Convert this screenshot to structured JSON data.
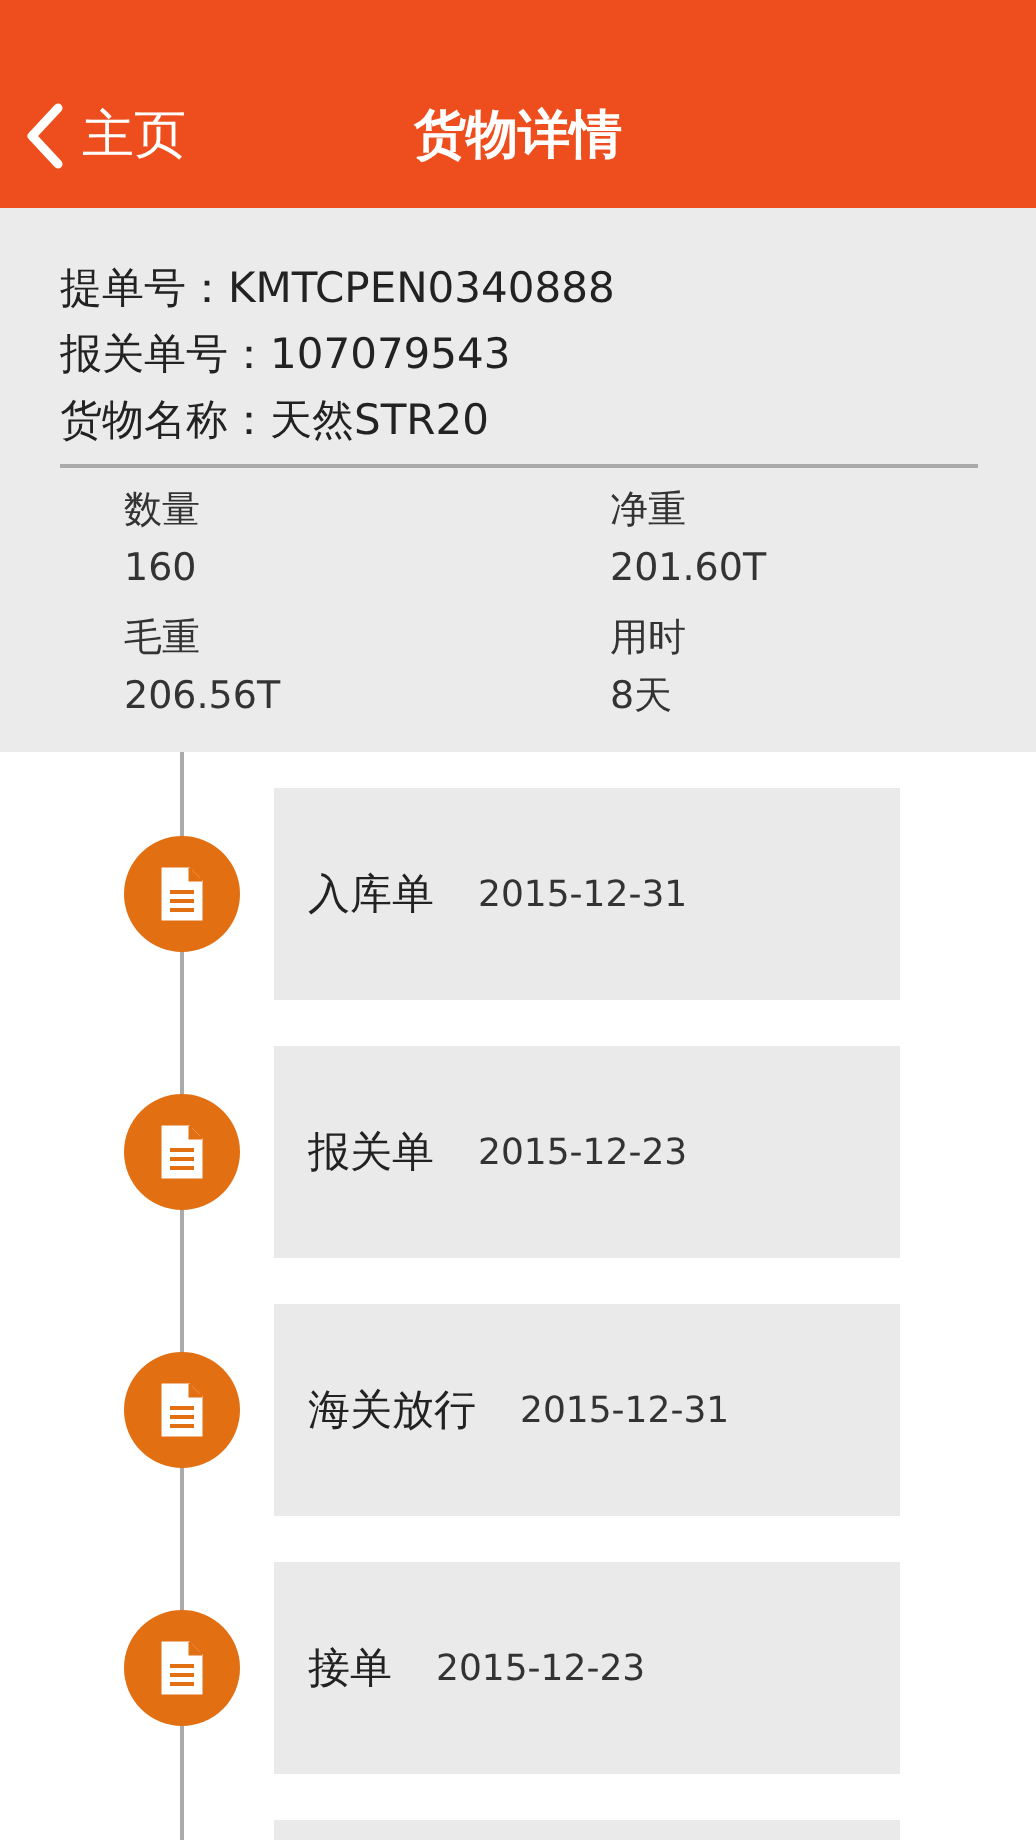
{
  "nav_bar": {
    "back_label": "主页",
    "title": "货物详情"
  },
  "summary": {
    "fields": [
      {
        "label": "提单号：",
        "value": "KMTCPEN0340888"
      },
      {
        "label": "报关单号：",
        "value": "107079543"
      },
      {
        "label": "货物名称：",
        "value": "天然STR20"
      }
    ],
    "stats": [
      {
        "label": "数量",
        "value": "160"
      },
      {
        "label": "净重",
        "value": "201.60T"
      },
      {
        "label": "毛重",
        "value": "206.56T"
      },
      {
        "label": "用时",
        "value": "8天"
      }
    ]
  },
  "timeline": [
    {
      "title": "入库单",
      "date": "2015-12-31"
    },
    {
      "title": "报关单",
      "date": "2015-12-23"
    },
    {
      "title": "海关放行",
      "date": "2015-12-31"
    },
    {
      "title": "接单",
      "date": "2015-12-23"
    }
  ]
}
